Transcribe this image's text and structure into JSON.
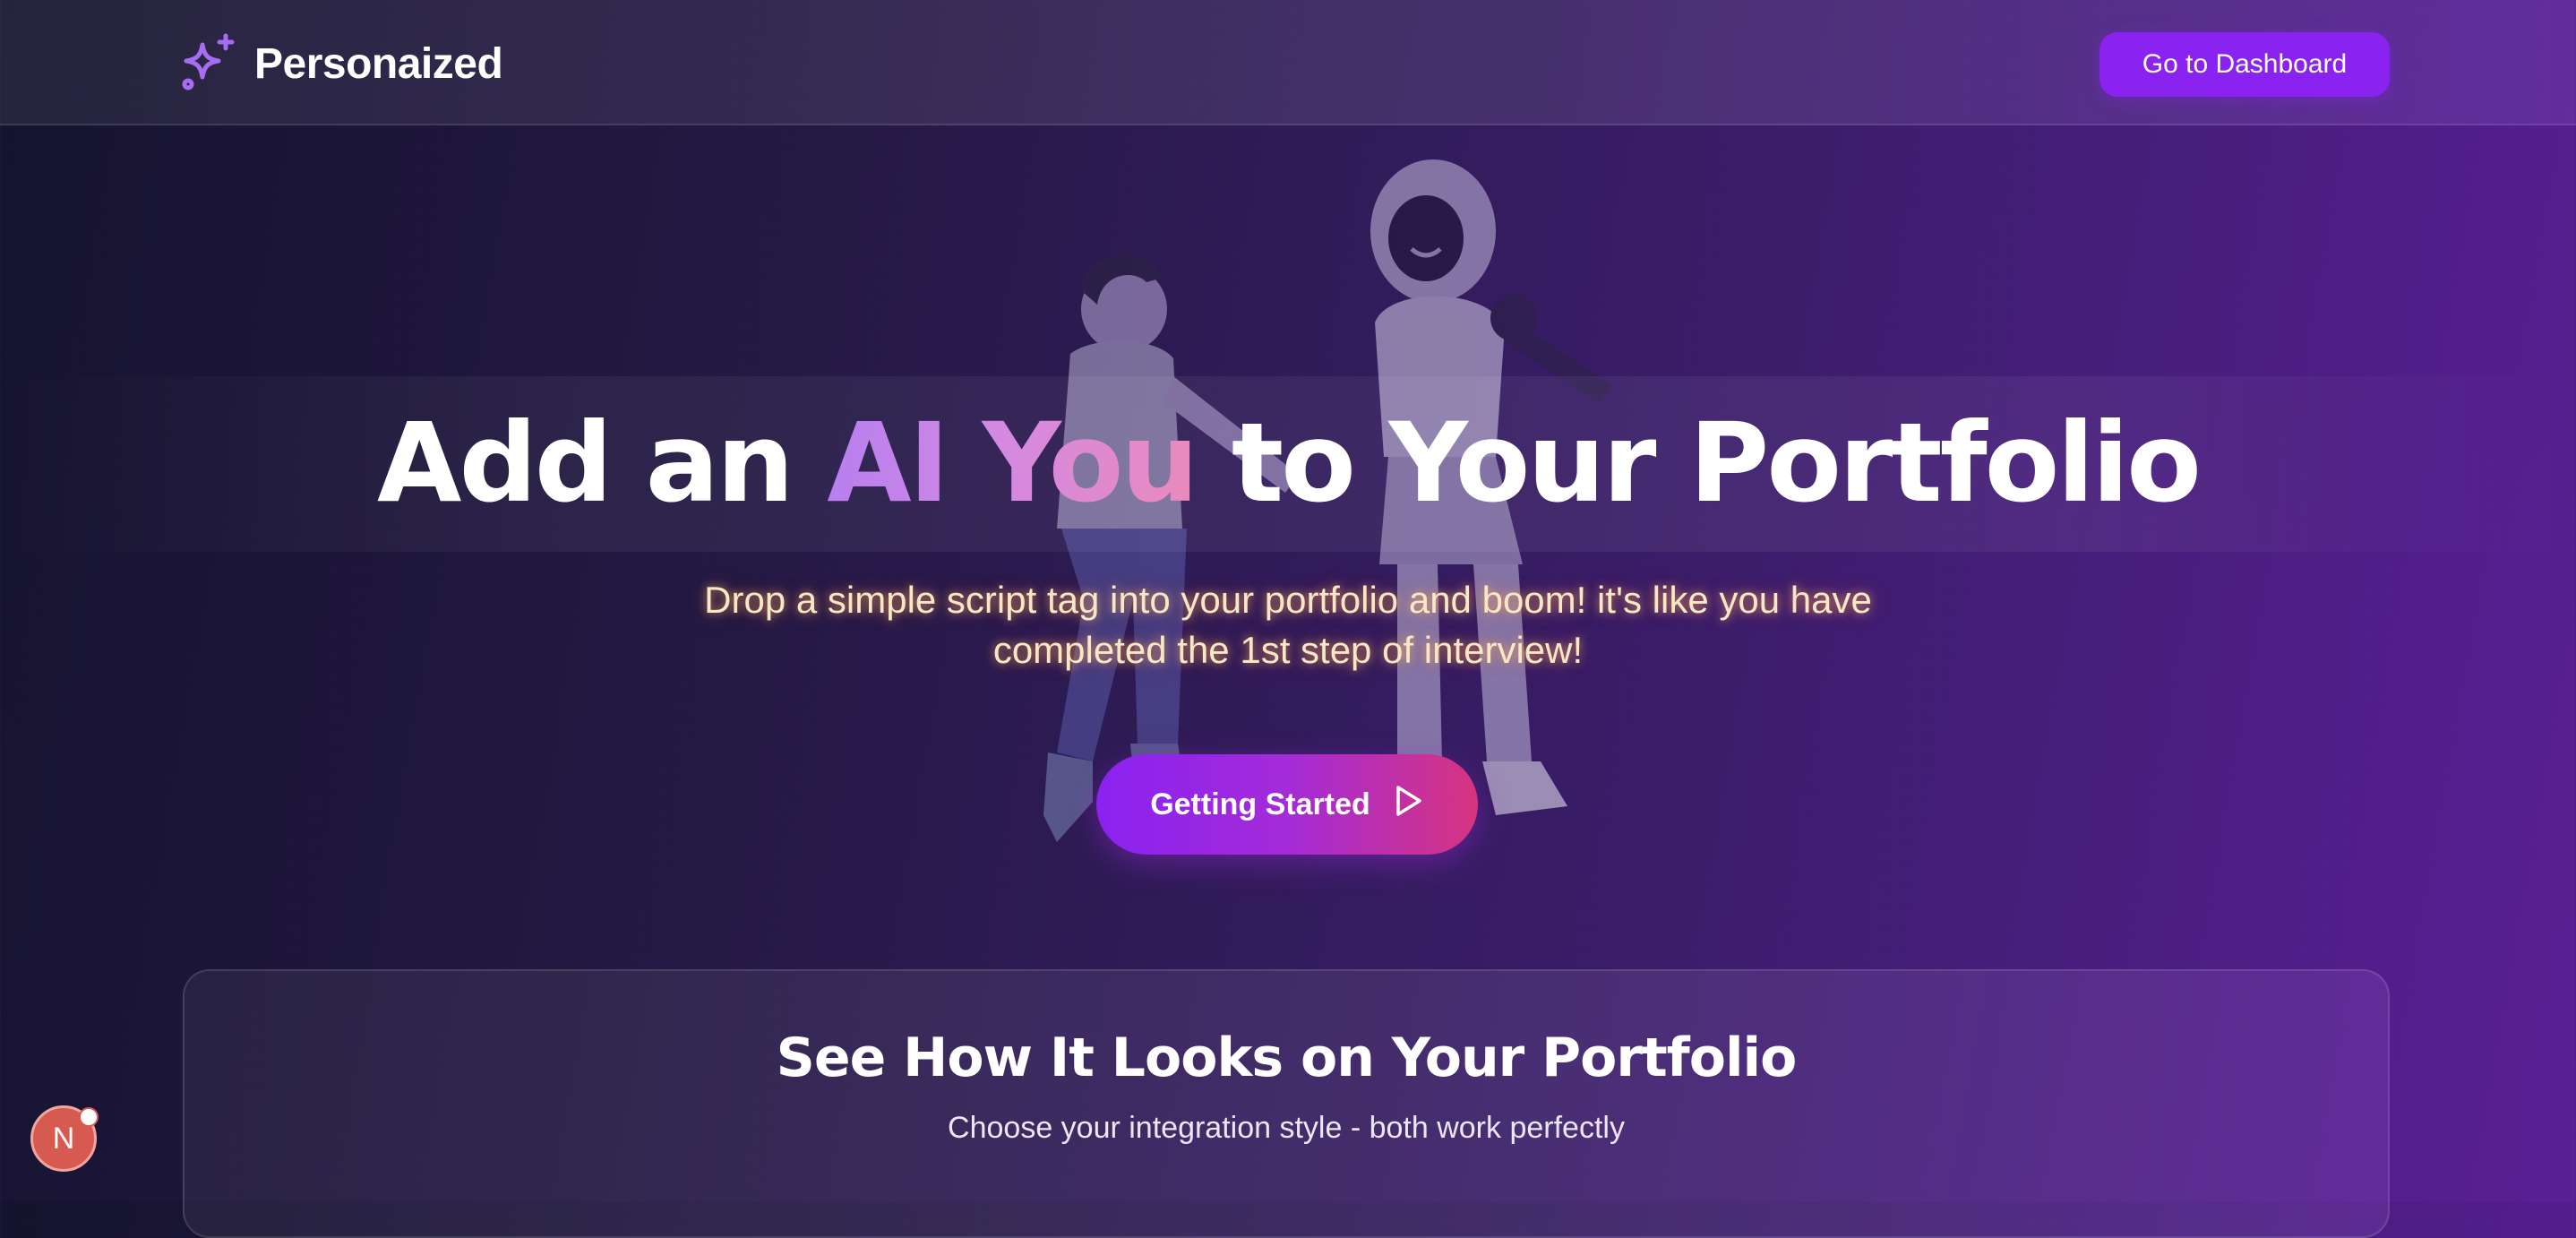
{
  "header": {
    "logo_text": "Personaized",
    "dashboard_button": "Go to Dashboard"
  },
  "hero": {
    "title_before": "Add an ",
    "title_highlight": "AI You",
    "title_after": " to Your Portfolio",
    "subtitle": "Drop a simple script tag into your portfolio and boom! it's like you have completed the 1st step of interview!",
    "cta_label": "Getting Started"
  },
  "preview": {
    "title": "See How It Looks on Your Portfolio",
    "subtitle": "Choose your integration style - both work perfectly"
  },
  "dev_badge": {
    "letter": "N"
  },
  "colors": {
    "accent": "#8a22f0",
    "cta_gradient_end": "#d6347f",
    "highlight_start": "#b77ff0",
    "highlight_end": "#e98abb",
    "subtitle_text": "#f6e7c6"
  },
  "icons": [
    "sparkles-icon",
    "play-icon"
  ]
}
